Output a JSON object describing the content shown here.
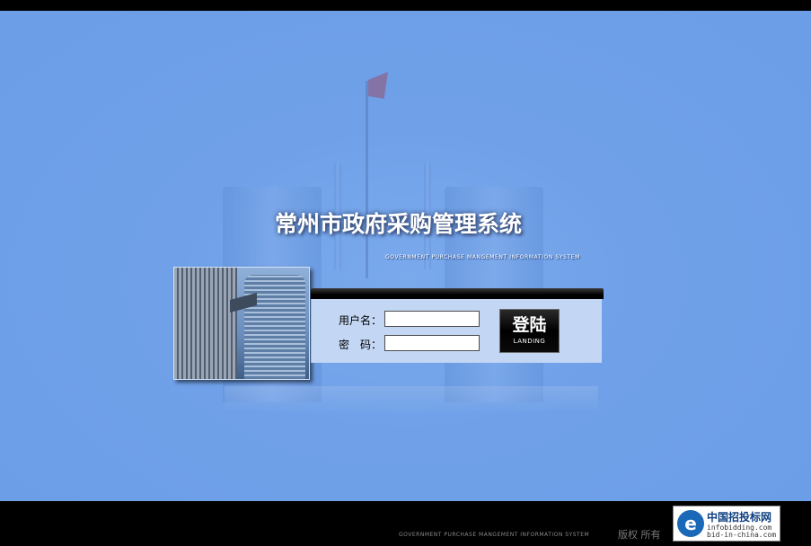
{
  "header": {
    "title": "常州市政府采购管理系统",
    "subtitle": "GOVERNMENT PURCHASE MANGEMENT INFORMATION SYSTEM"
  },
  "login": {
    "username_label": "用户名：",
    "username_value": "",
    "password_label": "密　码：",
    "password_value": "",
    "button_label": "登陆",
    "button_sublabel": "LANDING"
  },
  "footer": {
    "system_text": "GOVERNMENT PURCHASE MANGEMENT INFORMATION SYSTEM",
    "copyright": "版权 所有",
    "partner": {
      "name": "中国招投标网",
      "url1": "infobidding.com",
      "url2": "bid-in-china.com",
      "logo_letter": "e"
    }
  },
  "colors": {
    "background": "#6b9ee7",
    "panel": "#c3d6f4",
    "bars": "#000000"
  }
}
